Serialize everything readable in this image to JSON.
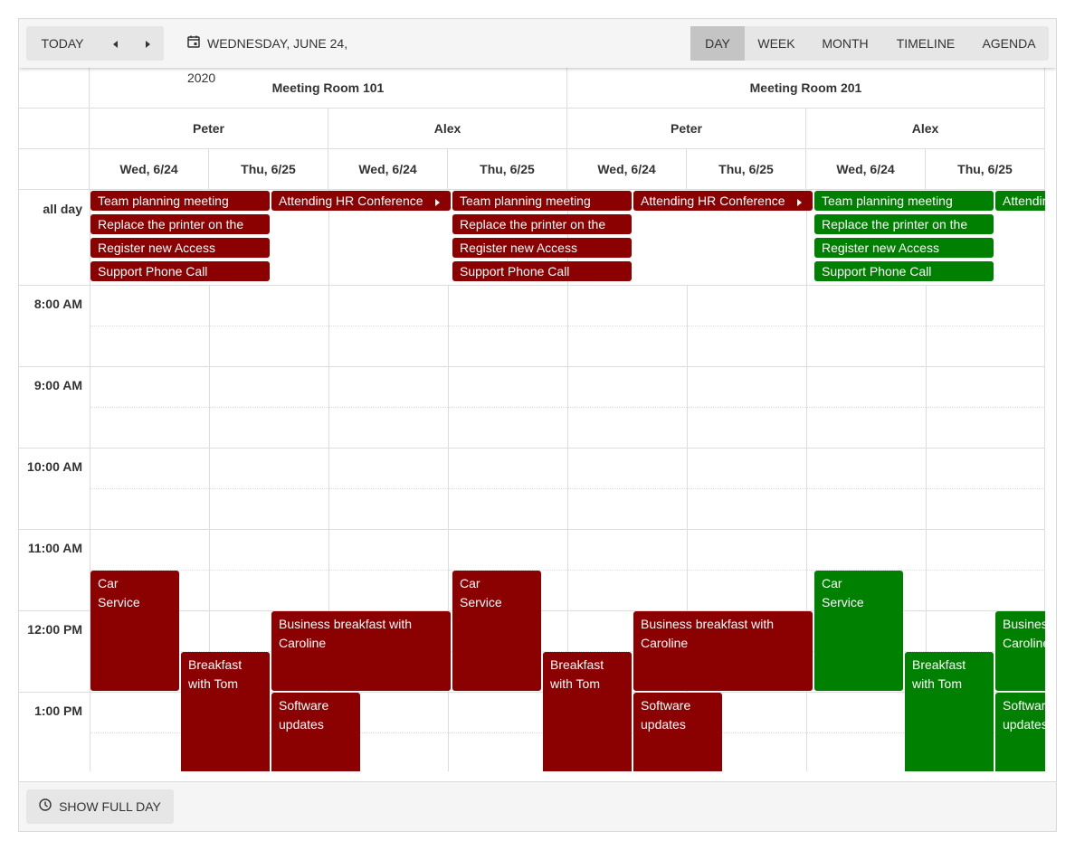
{
  "toolbar": {
    "today_label": "TODAY",
    "prev_icon": "triangle-left",
    "next_icon": "triangle-right",
    "date_label": "WEDNESDAY, JUNE 24, 2020",
    "calendar_icon": "calendar-icon",
    "views": [
      {
        "label": "DAY",
        "active": true
      },
      {
        "label": "WEEK",
        "active": false
      },
      {
        "label": "MONTH",
        "active": false
      },
      {
        "label": "TIMELINE",
        "active": false
      },
      {
        "label": "AGENDA",
        "active": false
      }
    ]
  },
  "rooms": [
    "Meeting Room 101",
    "Meeting Room 201"
  ],
  "people": [
    "Peter",
    "Alex",
    "Peter",
    "Alex"
  ],
  "dates": [
    "Wed, 6/24",
    "Thu, 6/25",
    "Wed, 6/24",
    "Thu, 6/25",
    "Wed, 6/24",
    "Thu, 6/25",
    "Wed, 6/24",
    "Thu, 6/25"
  ],
  "all_day_label": "all day",
  "times": [
    "8:00 AM",
    "9:00 AM",
    "10:00 AM",
    "11:00 AM",
    "12:00 PM",
    "1:00 PM"
  ],
  "colors": {
    "peter": "#8b0000",
    "alex_room201": "#008000"
  },
  "all_day_events": [
    {
      "title": "Team planning meeting",
      "group": "peter-101"
    },
    {
      "title": "Replace the printer on the",
      "group": "peter-101"
    },
    {
      "title": "Register new Access",
      "group": "peter-101"
    },
    {
      "title": "Support Phone Call",
      "group": "peter-101"
    },
    {
      "title": "Attending HR Conference",
      "group": "alex-101"
    }
  ],
  "timed_events": [
    {
      "title": "Car Service",
      "lines": [
        "Car",
        "Service"
      ]
    },
    {
      "title": "Breakfast with Tom",
      "lines": [
        "Breakfast",
        "with Tom"
      ]
    },
    {
      "title": "Business breakfast with Caroline",
      "lines": [
        "Business breakfast with",
        "Caroline"
      ]
    },
    {
      "title": "Software updates",
      "lines": [
        "Software",
        "updates"
      ]
    }
  ],
  "footer": {
    "show_full_day_label": "SHOW FULL DAY",
    "clock_icon": "clock-icon"
  }
}
